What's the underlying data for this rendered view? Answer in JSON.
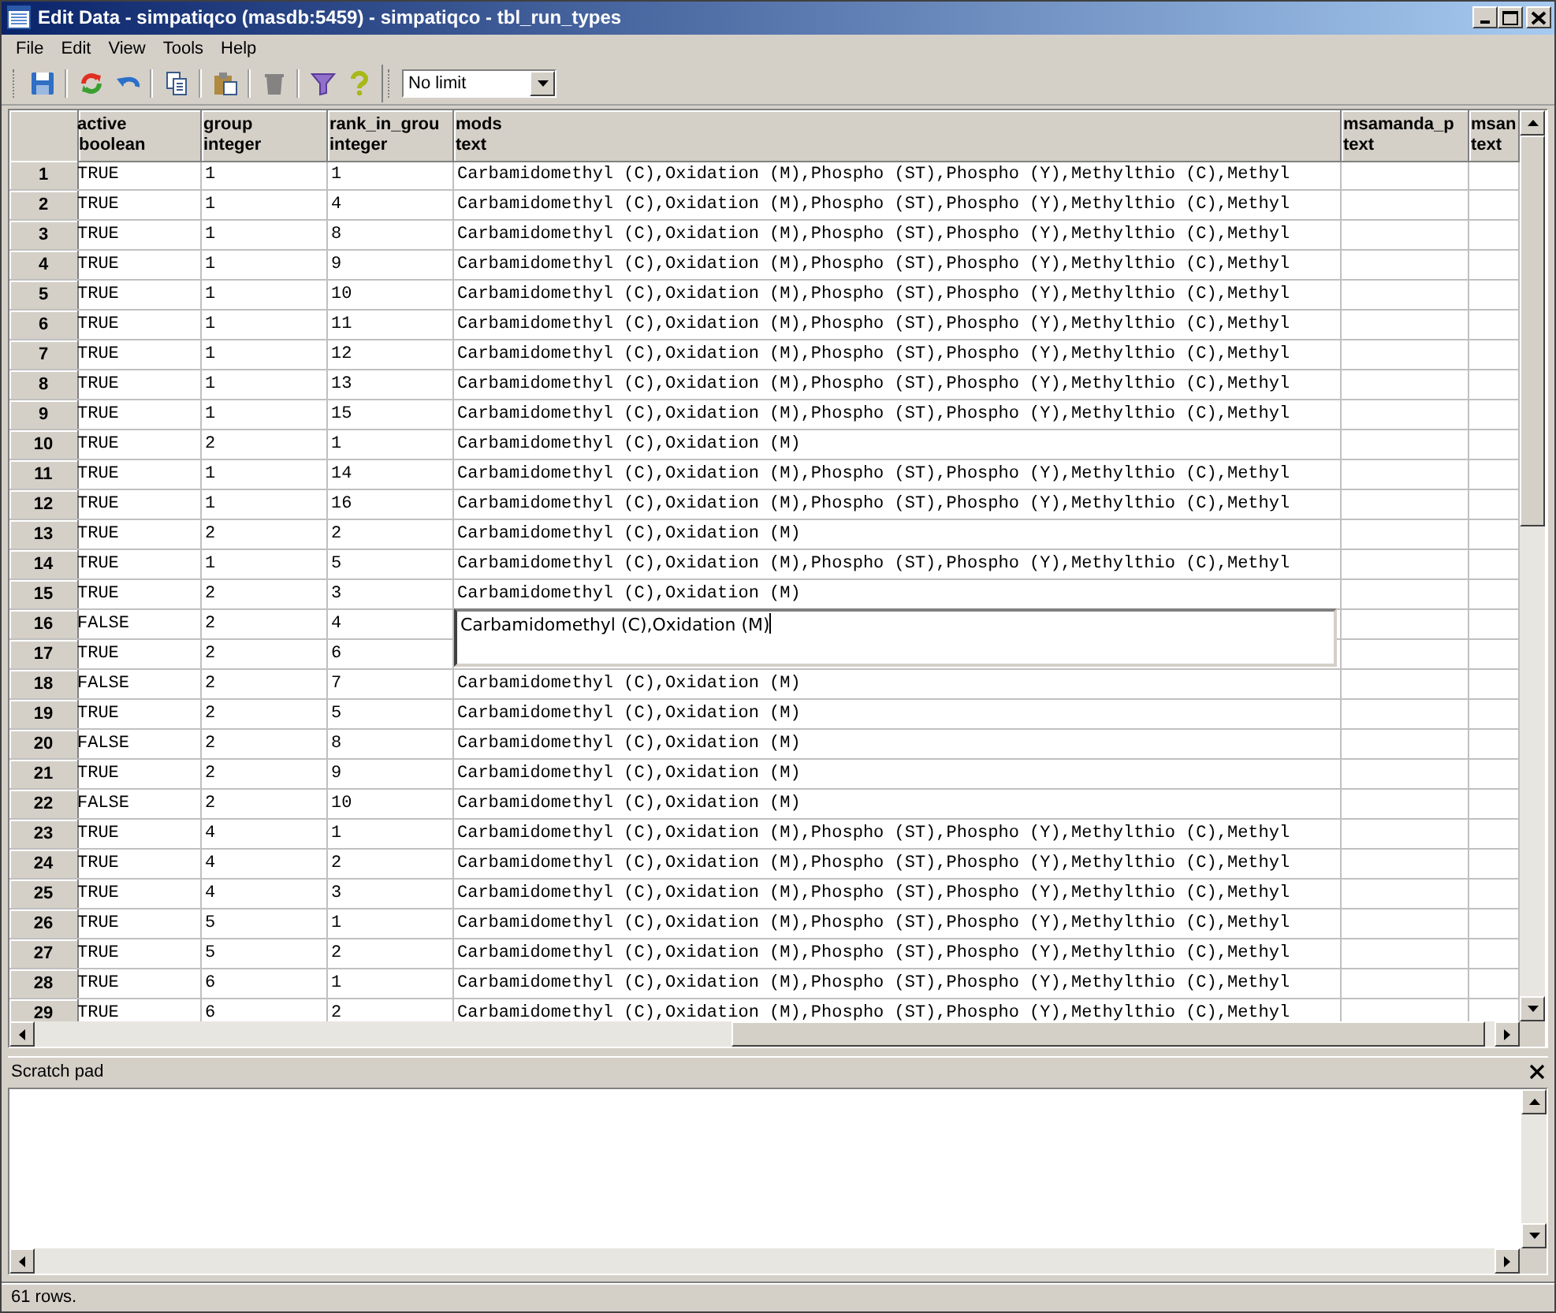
{
  "window": {
    "title": "Edit Data - simpatiqco (masdb:5459) - simpatiqco - tbl_run_types"
  },
  "menu": [
    "File",
    "Edit",
    "View",
    "Tools",
    "Help"
  ],
  "toolbar": {
    "buttons": [
      {
        "kind": "save",
        "disabled": false
      },
      {
        "kind": "refresh",
        "disabled": false
      },
      {
        "kind": "undo",
        "disabled": false
      },
      {
        "kind": "copy",
        "disabled": false
      },
      {
        "kind": "paste",
        "disabled": false
      },
      {
        "kind": "delete",
        "disabled": true
      },
      {
        "kind": "filter",
        "disabled": false
      },
      {
        "kind": "help",
        "disabled": false
      }
    ],
    "limit": "No limit"
  },
  "table": {
    "columns": [
      {
        "name": "active",
        "type": "boolean"
      },
      {
        "name": "group",
        "type": "integer"
      },
      {
        "name": "rank_in_grou",
        "type": "integer"
      },
      {
        "name": "mods",
        "type": "text"
      },
      {
        "name": "msamanda_p",
        "type": "text"
      },
      {
        "name": "msan",
        "type": "text"
      }
    ],
    "rows": [
      {
        "num": "1",
        "cells": [
          "TRUE",
          "1",
          "1",
          "Carbamidomethyl (C),Oxidation (M),Phospho (ST),Phospho (Y),Methylthio (C),Methyl"
        ],
        "editing": false
      },
      {
        "num": "2",
        "cells": [
          "TRUE",
          "1",
          "4",
          "Carbamidomethyl (C),Oxidation (M),Phospho (ST),Phospho (Y),Methylthio (C),Methyl"
        ],
        "editing": false
      },
      {
        "num": "3",
        "cells": [
          "TRUE",
          "1",
          "8",
          "Carbamidomethyl (C),Oxidation (M),Phospho (ST),Phospho (Y),Methylthio (C),Methyl"
        ],
        "editing": false
      },
      {
        "num": "4",
        "cells": [
          "TRUE",
          "1",
          "9",
          "Carbamidomethyl (C),Oxidation (M),Phospho (ST),Phospho (Y),Methylthio (C),Methyl"
        ],
        "editing": false
      },
      {
        "num": "5",
        "cells": [
          "TRUE",
          "1",
          "10",
          "Carbamidomethyl (C),Oxidation (M),Phospho (ST),Phospho (Y),Methylthio (C),Methyl"
        ],
        "editing": false
      },
      {
        "num": "6",
        "cells": [
          "TRUE",
          "1",
          "11",
          "Carbamidomethyl (C),Oxidation (M),Phospho (ST),Phospho (Y),Methylthio (C),Methyl"
        ],
        "editing": false
      },
      {
        "num": "7",
        "cells": [
          "TRUE",
          "1",
          "12",
          "Carbamidomethyl (C),Oxidation (M),Phospho (ST),Phospho (Y),Methylthio (C),Methyl"
        ],
        "editing": false
      },
      {
        "num": "8",
        "cells": [
          "TRUE",
          "1",
          "13",
          "Carbamidomethyl (C),Oxidation (M),Phospho (ST),Phospho (Y),Methylthio (C),Methyl"
        ],
        "editing": false
      },
      {
        "num": "9",
        "cells": [
          "TRUE",
          "1",
          "15",
          "Carbamidomethyl (C),Oxidation (M),Phospho (ST),Phospho (Y),Methylthio (C),Methyl"
        ],
        "editing": false
      },
      {
        "num": "10",
        "cells": [
          "TRUE",
          "2",
          "1",
          "Carbamidomethyl (C),Oxidation (M)"
        ],
        "editing": false
      },
      {
        "num": "11",
        "cells": [
          "TRUE",
          "1",
          "14",
          "Carbamidomethyl (C),Oxidation (M),Phospho (ST),Phospho (Y),Methylthio (C),Methyl"
        ],
        "editing": false
      },
      {
        "num": "12",
        "cells": [
          "TRUE",
          "1",
          "16",
          "Carbamidomethyl (C),Oxidation (M),Phospho (ST),Phospho (Y),Methylthio (C),Methyl"
        ],
        "editing": false
      },
      {
        "num": "13",
        "cells": [
          "TRUE",
          "2",
          "2",
          "Carbamidomethyl (C),Oxidation (M)"
        ],
        "editing": false
      },
      {
        "num": "14",
        "cells": [
          "TRUE",
          "1",
          "5",
          "Carbamidomethyl (C),Oxidation (M),Phospho (ST),Phospho (Y),Methylthio (C),Methyl"
        ],
        "editing": false
      },
      {
        "num": "15",
        "cells": [
          "TRUE",
          "2",
          "3",
          "Carbamidomethyl (C),Oxidation (M)"
        ],
        "editing": false
      },
      {
        "num": "16",
        "cells": [
          "FALSE",
          "2",
          "4",
          "Carbamidomethyl (C),Oxidation (M)"
        ],
        "editing": true
      },
      {
        "num": "17",
        "cells": [
          "TRUE",
          "2",
          "6"
        ],
        "editing": false
      },
      {
        "num": "18",
        "cells": [
          "FALSE",
          "2",
          "7",
          "Carbamidomethyl (C),Oxidation (M)"
        ],
        "editing": false
      },
      {
        "num": "19",
        "cells": [
          "TRUE",
          "2",
          "5",
          "Carbamidomethyl (C),Oxidation (M)"
        ],
        "editing": false
      },
      {
        "num": "20",
        "cells": [
          "FALSE",
          "2",
          "8",
          "Carbamidomethyl (C),Oxidation (M)"
        ],
        "editing": false
      },
      {
        "num": "21",
        "cells": [
          "TRUE",
          "2",
          "9",
          "Carbamidomethyl (C),Oxidation (M)"
        ],
        "editing": false
      },
      {
        "num": "22",
        "cells": [
          "FALSE",
          "2",
          "10",
          "Carbamidomethyl (C),Oxidation (M)"
        ],
        "editing": false
      },
      {
        "num": "23",
        "cells": [
          "TRUE",
          "4",
          "1",
          "Carbamidomethyl (C),Oxidation (M),Phospho (ST),Phospho (Y),Methylthio (C),Methyl"
        ],
        "editing": false
      },
      {
        "num": "24",
        "cells": [
          "TRUE",
          "4",
          "2",
          "Carbamidomethyl (C),Oxidation (M),Phospho (ST),Phospho (Y),Methylthio (C),Methyl"
        ],
        "editing": false
      },
      {
        "num": "25",
        "cells": [
          "TRUE",
          "4",
          "3",
          "Carbamidomethyl (C),Oxidation (M),Phospho (ST),Phospho (Y),Methylthio (C),Methyl"
        ],
        "editing": false
      },
      {
        "num": "26",
        "cells": [
          "TRUE",
          "5",
          "1",
          "Carbamidomethyl (C),Oxidation (M),Phospho (ST),Phospho (Y),Methylthio (C),Methyl"
        ],
        "editing": false
      },
      {
        "num": "27",
        "cells": [
          "TRUE",
          "5",
          "2",
          "Carbamidomethyl (C),Oxidation (M),Phospho (ST),Phospho (Y),Methylthio (C),Methyl"
        ],
        "editing": false
      },
      {
        "num": "28",
        "cells": [
          "TRUE",
          "6",
          "1",
          "Carbamidomethyl (C),Oxidation (M),Phospho (ST),Phospho (Y),Methylthio (C),Methyl"
        ],
        "editing": false
      },
      {
        "num": "29",
        "cells": [
          "TRUE",
          "6",
          "2",
          "Carbamidomethyl (C),Oxidation (M),Phospho (ST),Phospho (Y),Methylthio (C),Methyl"
        ],
        "editing": false
      }
    ]
  },
  "scratch_pad": {
    "title": "Scratch pad"
  },
  "status_bar": "61 rows."
}
